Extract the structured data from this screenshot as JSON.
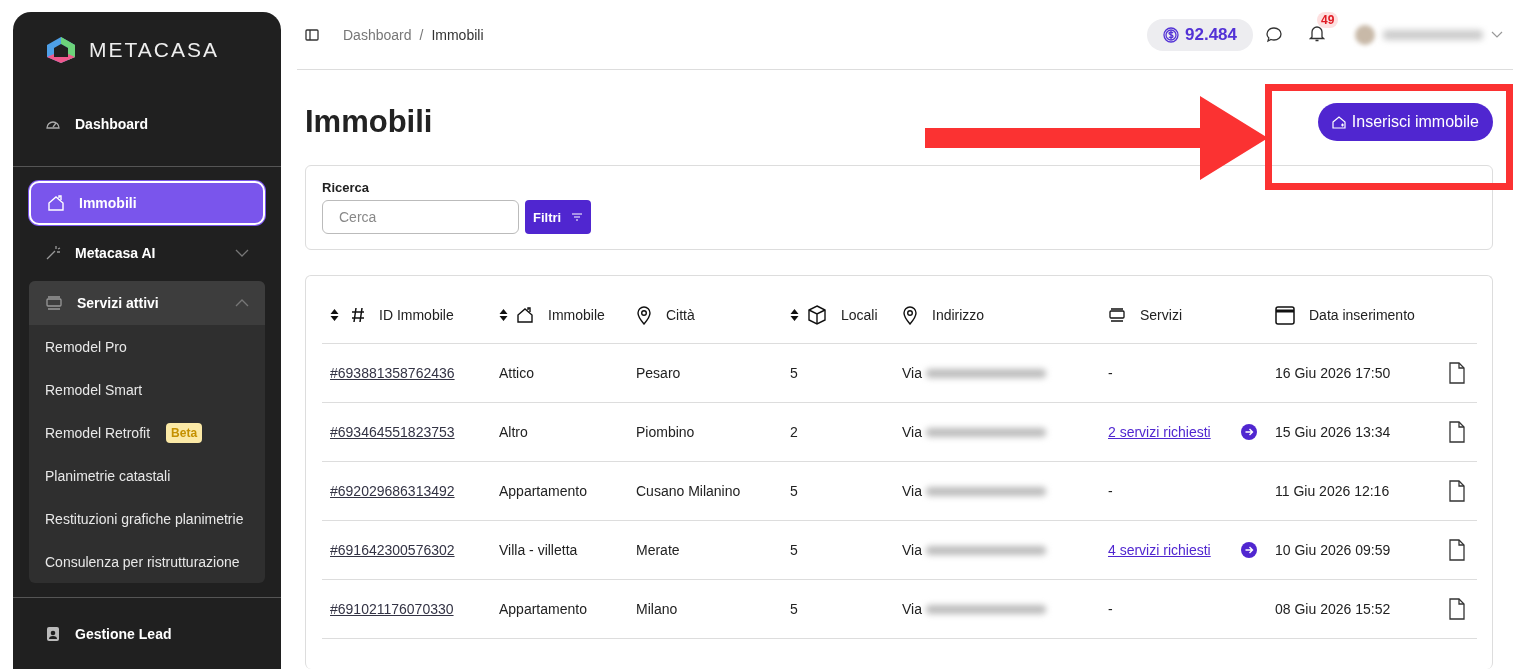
{
  "brand": {
    "name": "METACASA"
  },
  "sidebar": {
    "sections": [
      {
        "items": [
          {
            "label": "Dashboard",
            "selected": false
          }
        ]
      },
      {
        "items": [
          {
            "label": "Immobili",
            "selected": true
          },
          {
            "label": "Metacasa AI",
            "selected": false,
            "expanded": false
          },
          {
            "label": "Servizi attivi",
            "selected": false,
            "expanded": true,
            "children": [
              {
                "label": "Remodel Pro"
              },
              {
                "label": "Remodel Smart"
              },
              {
                "label": "Remodel Retrofit",
                "badge": "Beta"
              },
              {
                "label": "Planimetrie catastali"
              },
              {
                "label": "Restituzioni grafiche planimetrie"
              },
              {
                "label": "Consulenza per ristrutturazione"
              }
            ]
          }
        ]
      },
      {
        "items": [
          {
            "label": "Gestione Lead",
            "selected": false
          }
        ]
      }
    ]
  },
  "breadcrumb": {
    "items": [
      "Dashboard",
      "Immobili"
    ],
    "separator": "/"
  },
  "header": {
    "credits": "92.484",
    "notifications": "49"
  },
  "page_title": "Immobili",
  "add_button": "Inserisci immobile",
  "search": {
    "label": "Ricerca",
    "placeholder": "Cerca",
    "filter_button": "Filtri"
  },
  "table": {
    "columns": [
      {
        "label": "ID Immobile",
        "sortable": true
      },
      {
        "label": "Immobile",
        "sortable": true
      },
      {
        "label": "Città",
        "sortable": false
      },
      {
        "label": "Locali",
        "sortable": true
      },
      {
        "label": "Indirizzo",
        "sortable": false
      },
      {
        "label": "Servizi",
        "sortable": false
      },
      {
        "label": "Data inserimento",
        "sortable": false
      }
    ],
    "rows": [
      {
        "id": "#693881358762436",
        "type": "Attico",
        "city": "Pesaro",
        "rooms": "5",
        "address": "Via",
        "services": {
          "kind": "none",
          "text": "-"
        },
        "date": "16 Giu 2026 17:50"
      },
      {
        "id": "#693464551823753",
        "type": "Altro",
        "city": "Piombino",
        "rooms": "2",
        "address": "Via",
        "services": {
          "kind": "link",
          "text": "2 servizi richiesti"
        },
        "date": "15 Giu 2026 13:34"
      },
      {
        "id": "#692029686313492",
        "type": "Appartamento",
        "city": "Cusano Milanino",
        "rooms": "5",
        "address": "Via",
        "services": {
          "kind": "none",
          "text": "-"
        },
        "date": "11 Giu 2026 12:16"
      },
      {
        "id": "#691642300576302",
        "type": "Villa - villetta",
        "city": "Merate",
        "rooms": "5",
        "address": "Via",
        "services": {
          "kind": "link",
          "text": "4 servizi richiesti"
        },
        "date": "10 Giu 2026 09:59"
      },
      {
        "id": "#691021176070330",
        "type": "Appartamento",
        "city": "Milano",
        "rooms": "5",
        "address": "Via",
        "services": {
          "kind": "none",
          "text": "-"
        },
        "date": "08 Giu 2026 15:52"
      }
    ]
  }
}
